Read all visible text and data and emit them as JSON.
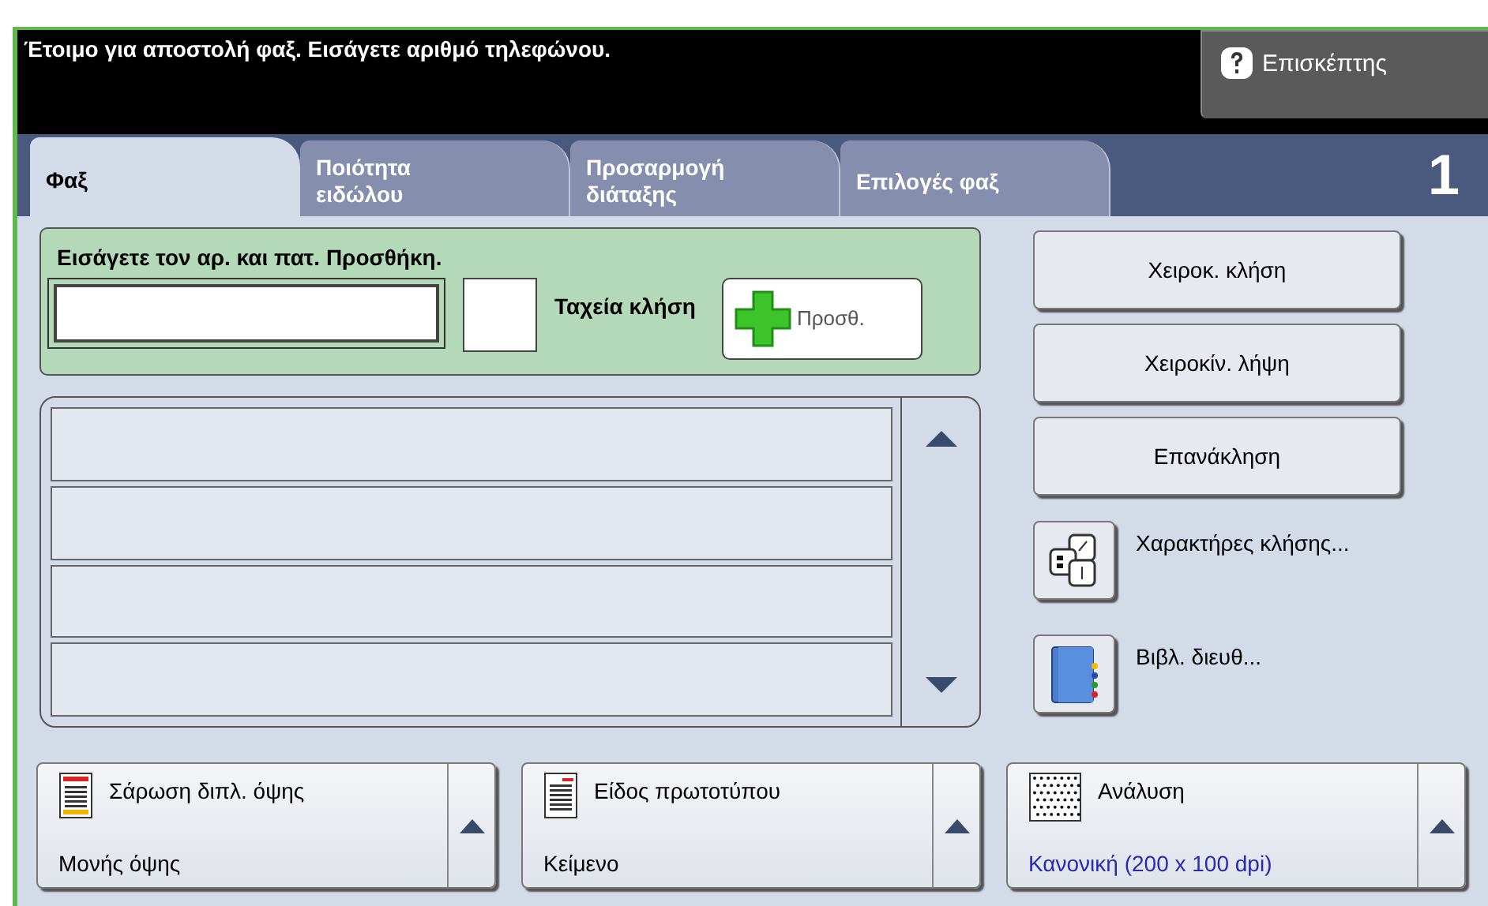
{
  "header": {
    "message": "Έτοιμο για αποστολή φαξ. Εισάγετε αριθμό τηλεφώνου.",
    "guest_button": "Επισκέπτης"
  },
  "tabs": [
    {
      "label": "Φαξ",
      "selected": true
    },
    {
      "label": "Ποιότητα ειδώλου",
      "selected": false
    },
    {
      "label": "Προσαρμογή διάταξης",
      "selected": false
    },
    {
      "label": "Επιλογές φαξ",
      "selected": false
    }
  ],
  "job_count": "1",
  "entry": {
    "prompt": "Εισάγετε τον αρ. και πατ. Προσθήκη.",
    "speed_dial_label": "Ταχεία κλήση",
    "add_button": "Προσθ."
  },
  "actions": [
    {
      "kind": "button",
      "label": "Χειροκ. κλήση"
    },
    {
      "kind": "button",
      "label": "Χειροκίν. λήψη"
    },
    {
      "kind": "button",
      "label": "Επανάκληση"
    },
    {
      "kind": "dial-chars",
      "label": "Χαρακτήρες κλήσης..."
    },
    {
      "kind": "address-book",
      "label": "Βιβλ. διευθ..."
    }
  ],
  "options": [
    {
      "kind": "duplex",
      "title": "Σάρωση διπλ. όψης",
      "value": "Μονής όψης",
      "highlighted": false
    },
    {
      "kind": "original",
      "title": "Είδος πρωτοτύπου",
      "value": "Κείμενο",
      "highlighted": false
    },
    {
      "kind": "resolution",
      "title": "Ανάλυση",
      "value": "Κανονική (200 x 100 dpi)",
      "highlighted": true
    }
  ]
}
